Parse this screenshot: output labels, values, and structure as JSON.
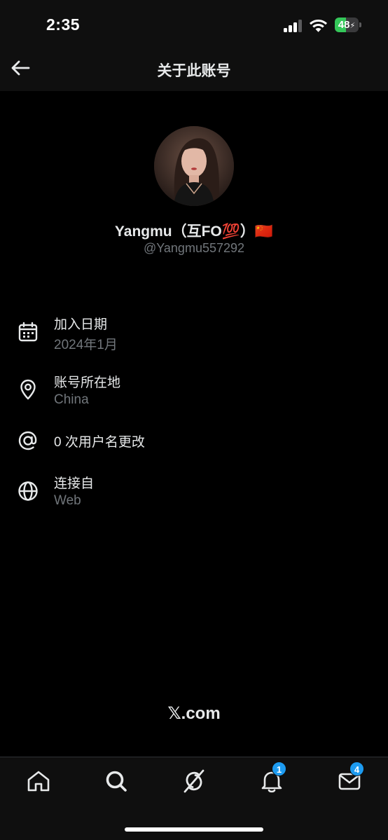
{
  "status_bar": {
    "time": "2:35",
    "battery_level": "48",
    "battery_fraction": 0.48,
    "icons": [
      "signal-icon",
      "wifi-icon",
      "battery-icon"
    ]
  },
  "header": {
    "title": "关于此账号",
    "back_icon": "back-arrow-icon"
  },
  "profile": {
    "display_name": "Yangmu（互FO💯）🇨🇳",
    "handle": "@Yangmu557292"
  },
  "info": [
    {
      "icon": "calendar-icon",
      "label": "加入日期",
      "value": "2024年1月"
    },
    {
      "icon": "location-pin-icon",
      "label": "账号所在地",
      "value": "China"
    },
    {
      "icon": "at-sign-icon",
      "label": "0 次用户名更改",
      "value": ""
    },
    {
      "icon": "globe-icon",
      "label": "连接自",
      "value": "Web"
    }
  ],
  "footer": {
    "brand_symbol": "𝕏",
    "brand_text": ".com"
  },
  "tab_bar": {
    "tabs": [
      {
        "name": "home",
        "icon": "home-icon",
        "badge": ""
      },
      {
        "name": "search",
        "icon": "search-icon",
        "badge": ""
      },
      {
        "name": "grok",
        "icon": "grok-icon",
        "badge": ""
      },
      {
        "name": "notifications",
        "icon": "bell-icon",
        "badge": "1"
      },
      {
        "name": "messages",
        "icon": "mail-icon",
        "badge": "4"
      }
    ]
  },
  "colors": {
    "background": "#000000",
    "bar": "#0f0f0f",
    "text_primary": "#e7e9ea",
    "text_secondary": "#71767b",
    "accent": "#1d9bf0",
    "battery": "#34c759"
  }
}
